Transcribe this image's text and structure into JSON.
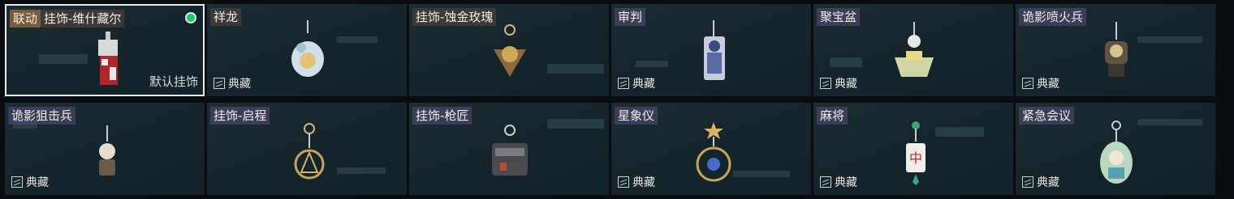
{
  "labels": {
    "default_charm": "默认挂饰",
    "collection": "典藏",
    "collab": "联动"
  },
  "items": [
    {
      "name": "挂饰-维什藏尔",
      "collab": true,
      "selected": true,
      "equipped": true,
      "collection": false
    },
    {
      "name": "祥龙",
      "collection": true
    },
    {
      "name": "挂饰-蚀金玫瑰",
      "collection": false
    },
    {
      "name": "审判",
      "collection": true
    },
    {
      "name": "聚宝盆",
      "collection": true
    },
    {
      "name": "诡影喷火兵",
      "collection": true
    },
    {
      "name": "诡影狙击兵",
      "collection": true
    },
    {
      "name": "挂饰-启程",
      "collection": false
    },
    {
      "name": "挂饰-枪匠",
      "collection": false
    },
    {
      "name": "星象仪",
      "collection": true
    },
    {
      "name": "麻将",
      "collection": true
    },
    {
      "name": "紧急会议",
      "collection": true
    }
  ],
  "colors": {
    "selected_border": "#e8ecef",
    "equipped_dot": "#21c46a",
    "collab_tag": "#7a5a3c"
  }
}
